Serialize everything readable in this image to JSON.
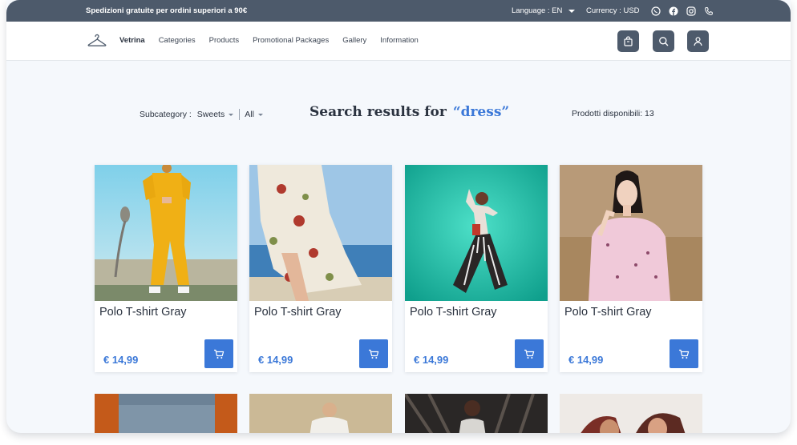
{
  "topbar": {
    "promo": "Spedizioni gratuite per ordini superiori a 90€",
    "language": "Language : EN",
    "currency": "Currency : USD",
    "social_icons": [
      "whatsapp-icon",
      "facebook-icon",
      "instagram-icon",
      "phone-icon"
    ]
  },
  "nav": {
    "items": [
      "Vetrina",
      "Categories",
      "Products",
      "Promotional Packages",
      "Gallery",
      "Information"
    ],
    "active": "Vetrina",
    "buttons": [
      "cart-icon",
      "search-icon",
      "user-icon"
    ]
  },
  "search": {
    "subcategory_label": "Subcategory :",
    "subcategory_value": "Sweets",
    "filter_value": "All",
    "title": "Search results for",
    "query": "“dress”",
    "available": "Prodotti disponibili: 13"
  },
  "products": [
    {
      "name": "Polo T-shirt Gray",
      "price": "€ 14,99"
    },
    {
      "name": "Polo T-shirt Gray",
      "price": "€ 14,99"
    },
    {
      "name": "Polo T-shirt Gray",
      "price": "€ 14,99"
    },
    {
      "name": "Polo T-shirt Gray",
      "price": "€ 14,99"
    }
  ],
  "colors": {
    "accent": "#3b78d8",
    "dark": "#4d5a6b",
    "background": "#f5f8fc"
  }
}
